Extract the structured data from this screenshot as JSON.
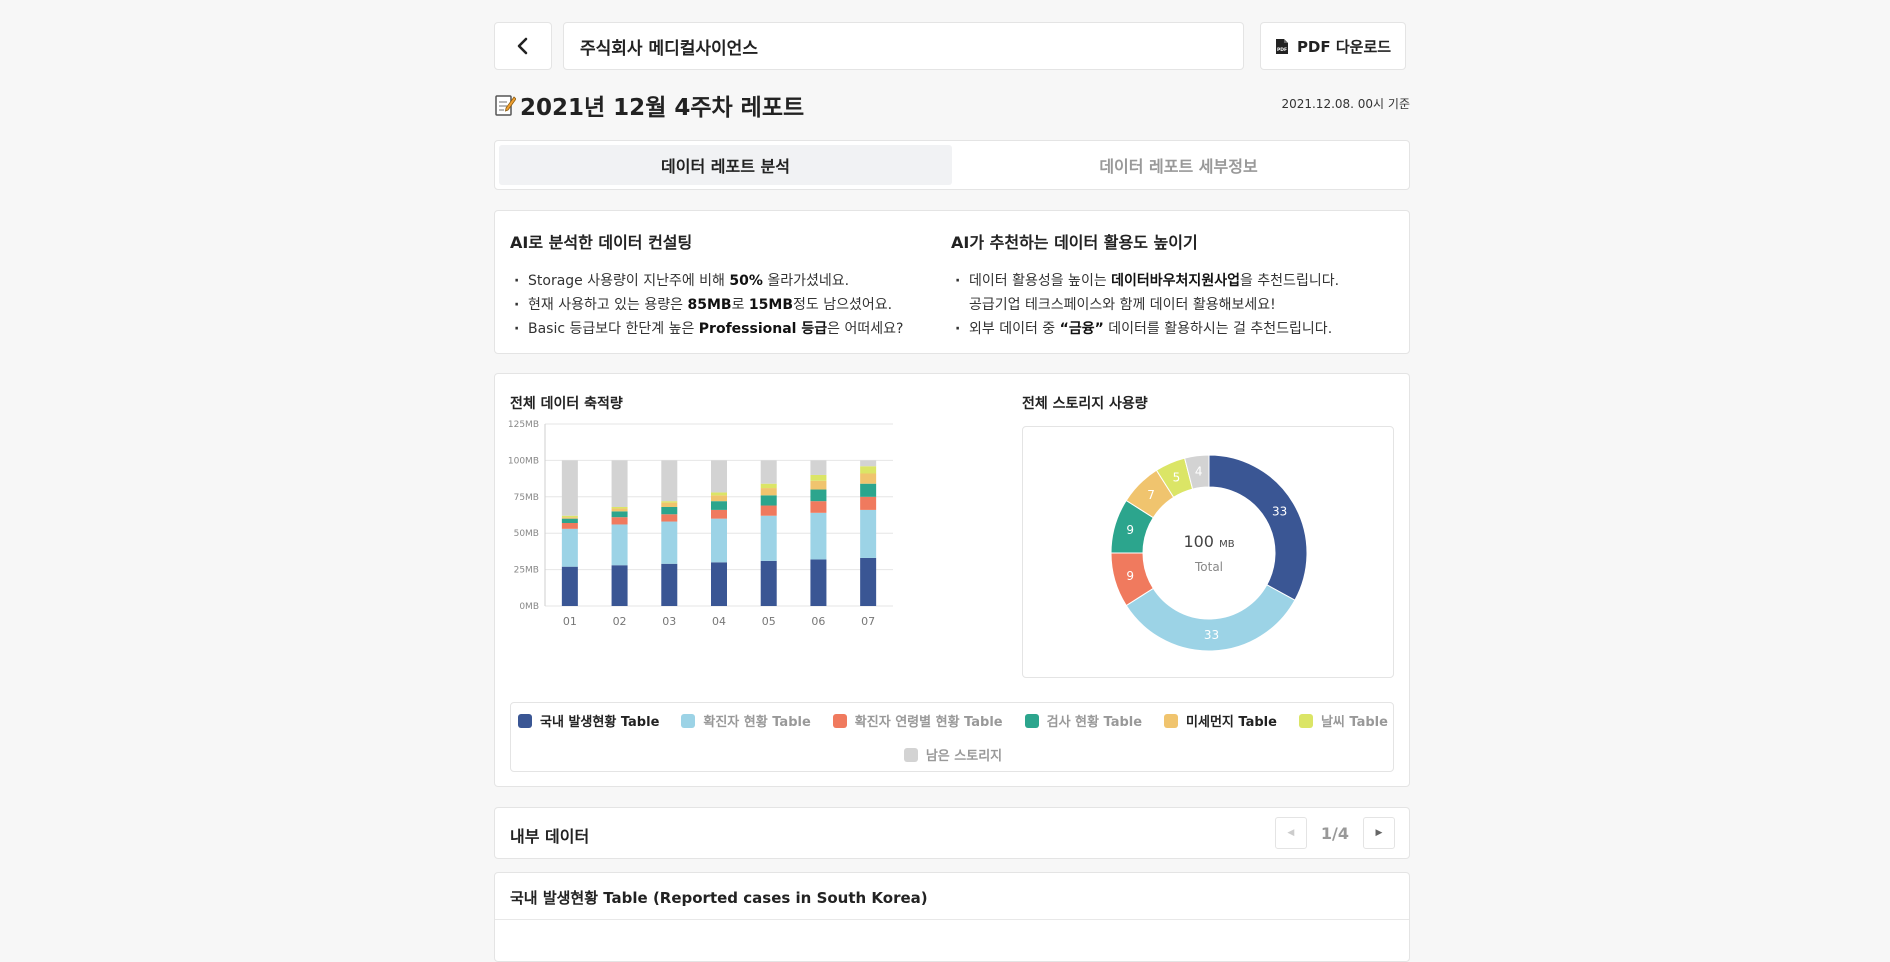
{
  "header": {
    "company_name": "주식회사 메디컬사이언스",
    "pdf_button_label": "PDF 다운로드"
  },
  "title": {
    "text": "2021년 12월 4주차 레포트",
    "base_date": "2021.12.08. 00시 기준"
  },
  "tabs": [
    {
      "label": "데이터 레포트 분석",
      "active": true
    },
    {
      "label": "데이터 레포트 세부정보",
      "active": false
    }
  ],
  "consulting": {
    "left_title": "AI로 분석한 데이터 컨설팅",
    "left_items": [
      [
        "Storage 사용량이 지난주에 비해 ",
        "50%",
        " 올라가셨네요."
      ],
      [
        "현재 사용하고 있는 용량은 ",
        "85MB",
        "로 ",
        "15MB",
        "정도 남으셨어요."
      ],
      [
        "Basic 등급보다 한단계 높은 ",
        "Professional 등급",
        "은 어떠세요?"
      ]
    ],
    "right_title": "AI가 추천하는 데이터 활용도 높이기",
    "right_items": [
      [
        "데이터 활용성을 높이는 ",
        "데이터바우처지원사업",
        "을 추천드립니다."
      ],
      [
        "공급기업 테크스페이스와 함께 데이터 활용해보세요!"
      ],
      [
        "외부 데이터 중 ",
        "“금융”",
        " 데이터를 활용하시는 걸 추천드립니다."
      ]
    ]
  },
  "charts": {
    "bar_title": "전체 데이터 축적량",
    "donut_title": "전체 스토리지 사용량"
  },
  "colors": {
    "navy": "#3a5694",
    "lightblue": "#9cd3e6",
    "coral": "#f07a5e",
    "teal": "#2ca58d",
    "orange": "#f0c46e",
    "lime": "#dbe566",
    "gray": "#d3d3d3"
  },
  "chart_data": [
    {
      "type": "bar",
      "stacked": true,
      "title": "전체 데이터 축적량",
      "categories": [
        "01",
        "02",
        "03",
        "04",
        "05",
        "06",
        "07"
      ],
      "y_ticks": [
        "0MB",
        "25MB",
        "50MB",
        "75MB",
        "100MB",
        "125MB"
      ],
      "ylim": [
        0,
        125
      ],
      "grid": true,
      "series": [
        {
          "name": "국내 발생현황 Table",
          "color": "#3a5694",
          "values": [
            27,
            28,
            29,
            30,
            31,
            32,
            33
          ]
        },
        {
          "name": "확진자 현황 Table",
          "color": "#9cd3e6",
          "values": [
            26,
            28,
            29,
            30,
            31,
            32,
            33
          ]
        },
        {
          "name": "확진자 연령별 현황 Table",
          "color": "#f07a5e",
          "values": [
            4,
            5,
            5,
            6,
            7,
            8,
            9
          ]
        },
        {
          "name": "검사 현황 Table",
          "color": "#2ca58d",
          "values": [
            3,
            4,
            5,
            6,
            7,
            8,
            9
          ]
        },
        {
          "name": "미세먼지 Table",
          "color": "#f0c46e",
          "values": [
            1,
            2,
            3,
            4,
            5,
            6,
            7
          ]
        },
        {
          "name": "날씨 Table",
          "color": "#dbe566",
          "values": [
            1,
            1,
            1,
            2,
            3,
            4,
            5
          ]
        },
        {
          "name": "남은 스토리지",
          "color": "#d3d3d3",
          "values": [
            38,
            32,
            28,
            22,
            16,
            10,
            4
          ]
        }
      ]
    },
    {
      "type": "pie",
      "donut": true,
      "title": "전체 스토리지 사용량",
      "center_value": "100",
      "center_unit": "MB",
      "center_label": "Total",
      "slices": [
        {
          "label": "국내 발생현황 Table",
          "value": 33,
          "color": "#3a5694"
        },
        {
          "label": "확진자 현황 Table",
          "value": 33,
          "color": "#9cd3e6"
        },
        {
          "label": "확진자 연령별 현황 Table",
          "value": 9,
          "color": "#f07a5e"
        },
        {
          "label": "검사 현황 Table",
          "value": 9,
          "color": "#2ca58d"
        },
        {
          "label": "미세먼지 Table",
          "value": 7,
          "color": "#f0c46e"
        },
        {
          "label": "날씨 Table",
          "value": 5,
          "color": "#dbe566"
        },
        {
          "label": "남은 스토리지",
          "value": 4,
          "color": "#d3d3d3"
        }
      ]
    }
  ],
  "legend": [
    {
      "label": "국내 발생현황 Table",
      "color": "#3a5694",
      "active": true
    },
    {
      "label": "확진자 현황 Table",
      "color": "#9cd3e6",
      "active": false
    },
    {
      "label": "확진자 연령별 현황 Table",
      "color": "#f07a5e",
      "active": false
    },
    {
      "label": "검사 현황 Table",
      "color": "#2ca58d",
      "active": false
    },
    {
      "label": "미세먼지 Table",
      "color": "#f0c46e",
      "active": true
    },
    {
      "label": "날씨 Table",
      "color": "#dbe566",
      "active": false
    },
    {
      "label": "남은 스토리지",
      "color": "#d3d3d3",
      "active": false
    }
  ],
  "internal": {
    "title": "내부 데이터",
    "page_indicator": "1/4"
  },
  "table_card": {
    "title": "국내 발생현황 Table (Reported cases in South Korea)"
  }
}
